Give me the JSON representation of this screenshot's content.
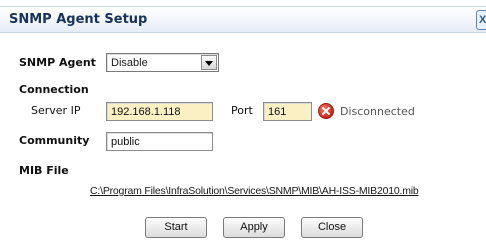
{
  "dialog": {
    "title": "SNMP Agent Setup",
    "close_glyph": "X"
  },
  "agent": {
    "label": "SNMP Agent",
    "selected": "Disable"
  },
  "connection": {
    "heading": "Connection",
    "server_ip_label": "Server IP",
    "server_ip_value": "192.168.1.118",
    "port_label": "Port",
    "port_value": "161",
    "status_text": "Disconnected",
    "status_icon": "error-icon",
    "status_color": "#c7271a"
  },
  "community": {
    "label": "Community",
    "value": "public"
  },
  "mib": {
    "label": "MIB File",
    "path": "C:\\Program Files\\InfraSolution\\Services\\SNMP\\MIB\\AH-ISS-MIB2010.mib"
  },
  "buttons": {
    "start": "Start",
    "apply": "Apply",
    "close": "Close"
  },
  "colors": {
    "title_text": "#17335c",
    "input_highlight": "#fbefc4"
  }
}
